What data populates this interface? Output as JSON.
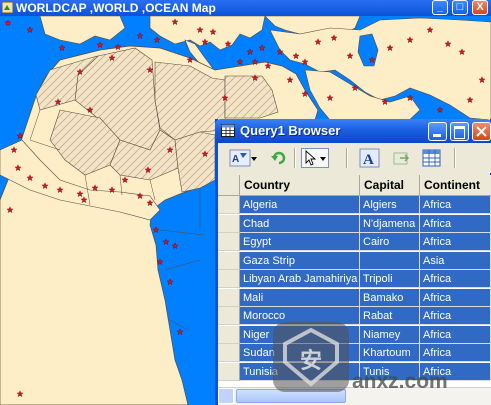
{
  "map_window": {
    "title": "WORLDCAP ,WORLD ,OCEAN Map",
    "buttons": [
      "_",
      "□",
      "X"
    ]
  },
  "query_window": {
    "title": "Query1 Browser",
    "toolbar_icons": [
      "filter-sort-icon",
      "refresh-icon",
      "select-arrow-icon",
      "text-style-icon",
      "export-icon",
      "grid-view-icon"
    ],
    "columns": [
      "Country",
      "Capital",
      "Continent"
    ],
    "rows": [
      {
        "country": "Algeria",
        "capital": "Algiers",
        "continent": "Africa"
      },
      {
        "country": "Chad",
        "capital": "N'djamena",
        "continent": "Africa"
      },
      {
        "country": "Egypt",
        "capital": "Cairo",
        "continent": "Africa"
      },
      {
        "country": "Gaza Strip",
        "capital": "",
        "continent": "Asia"
      },
      {
        "country": "Libyan Arab Jamahiriya",
        "capital": "Tripoli",
        "continent": "Africa"
      },
      {
        "country": "Mali",
        "capital": "Bamako",
        "continent": "Africa"
      },
      {
        "country": "Morocco",
        "capital": "Rabat",
        "continent": "Africa"
      },
      {
        "country": "Niger",
        "capital": "Niamey",
        "continent": "Africa"
      },
      {
        "country": "Sudan",
        "capital": "Khartoum",
        "continent": "Africa"
      },
      {
        "country": "Tunisia",
        "capital": "Tunis",
        "continent": "Africa"
      }
    ],
    "selection_color": "#316ac5"
  },
  "colors": {
    "ocean": "#0080ff",
    "land": "#fdeec8",
    "highlight_land": "#f3e3c3",
    "capital_star": "#d8141e",
    "titlebar": "#0a52d6"
  },
  "watermark": {
    "logo_glyph": "安",
    "text": "anxz.com"
  }
}
